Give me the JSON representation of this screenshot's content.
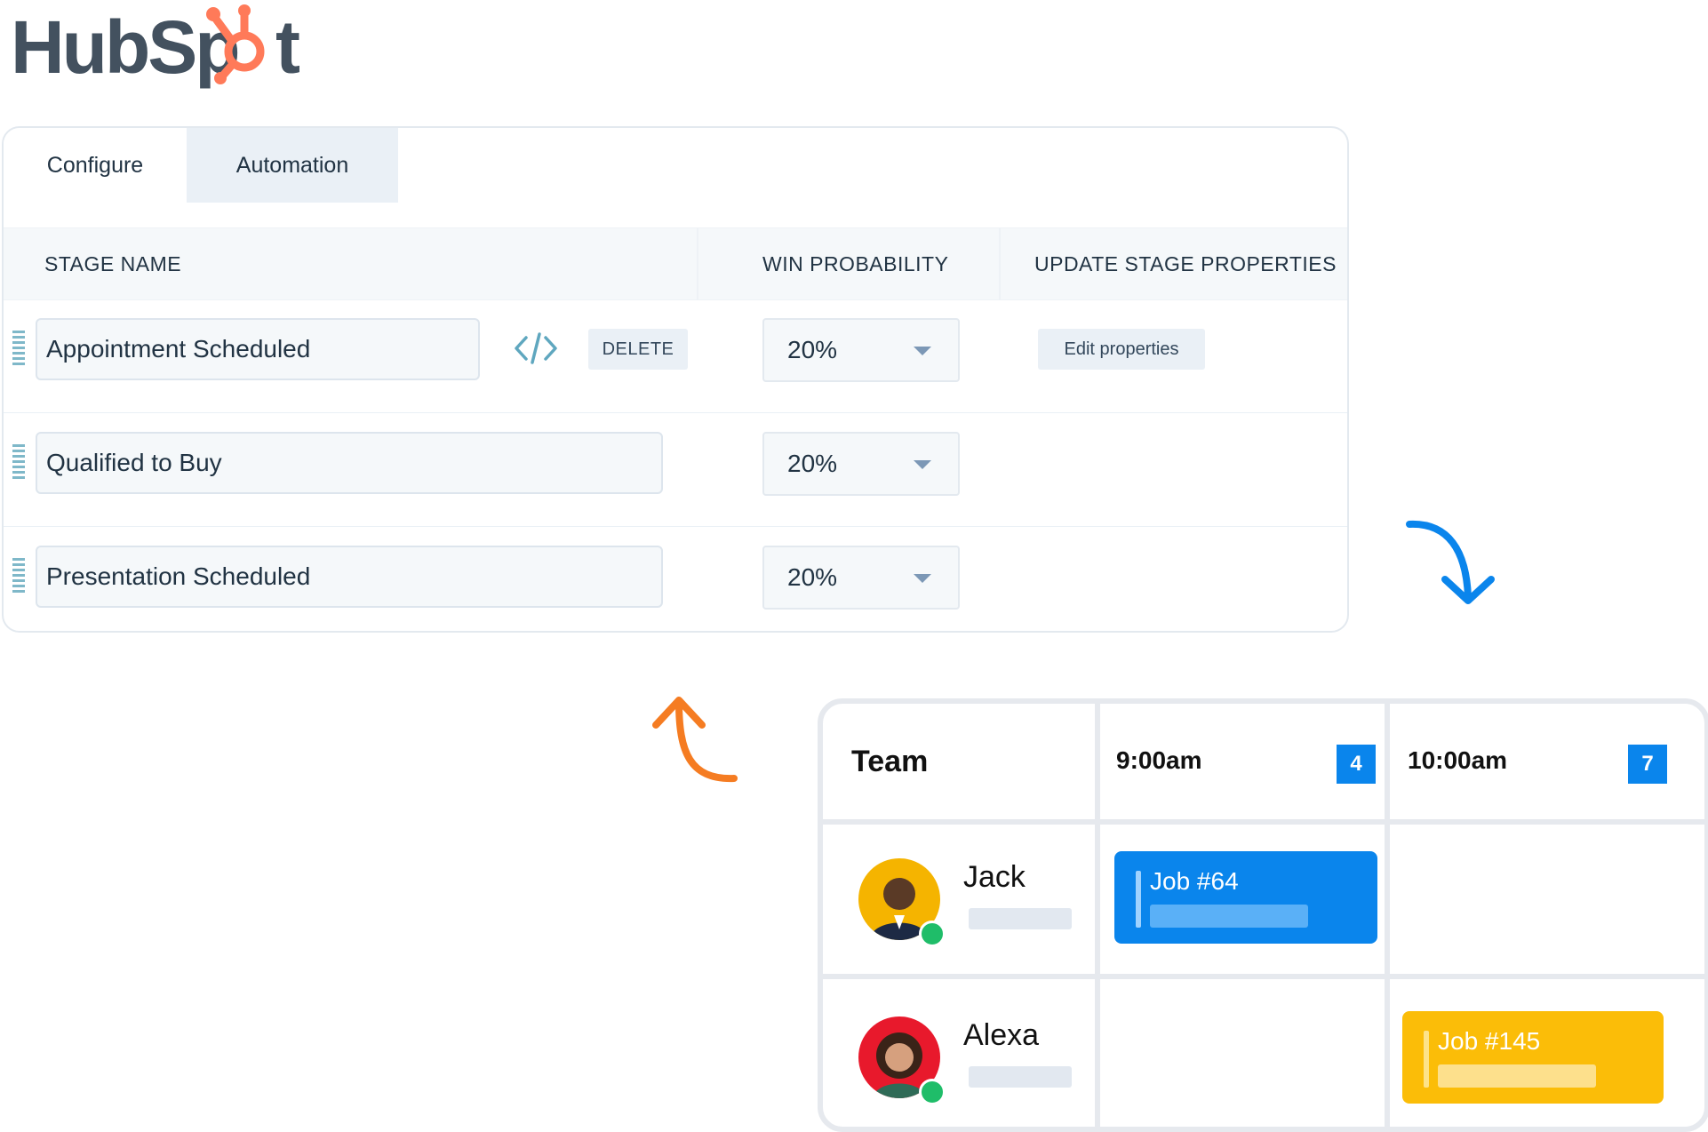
{
  "brand": {
    "name": "HubSpot",
    "accent": "#ff7a59",
    "dark": "#2d3e50"
  },
  "pipeline": {
    "tabs": [
      {
        "label": "Configure",
        "active": true
      },
      {
        "label": "Automation",
        "active": false
      }
    ],
    "columns": {
      "stage_name": "STAGE NAME",
      "win_probability": "WIN PROBABILITY",
      "update_stage_properties": "UPDATE STAGE PROPERTIES"
    },
    "rows": [
      {
        "stage": "Appointment Scheduled",
        "probability": "20%",
        "delete_label": "DELETE",
        "edit_label": "Edit properties"
      },
      {
        "stage": "Qualified to Buy",
        "probability": "20%"
      },
      {
        "stage": "Presentation Scheduled",
        "probability": "20%"
      }
    ]
  },
  "arrows": {
    "down_color": "#0a85ec",
    "up_color": "#f57c22"
  },
  "schedule": {
    "team_label": "Team",
    "slots": [
      {
        "time": "9:00am",
        "count": "4"
      },
      {
        "time": "10:00am",
        "count": "7"
      }
    ],
    "people": [
      {
        "name": "Jack",
        "status": "online",
        "job": "Job #64",
        "job_color": "#0a85ec"
      },
      {
        "name": "Alexa",
        "status": "online",
        "job": "Job #145",
        "job_color": "#fbbd08"
      }
    ]
  }
}
